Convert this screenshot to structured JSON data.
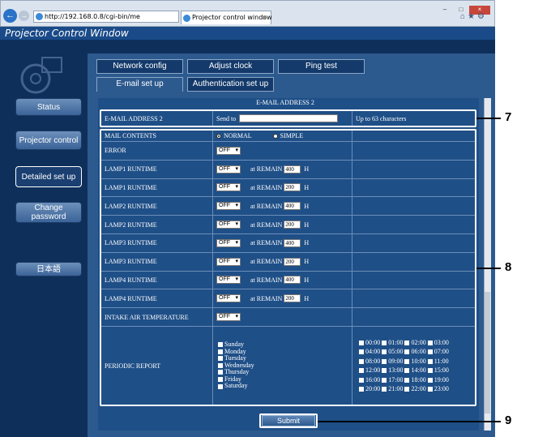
{
  "browser": {
    "address": "http://192.168.0.8/cgi-bin/me",
    "tab_title": "Projector control window"
  },
  "app_title": "Projector Control Window",
  "sidebar": [
    "Status",
    "Projector control",
    "Detailed set up",
    "Change password",
    "日本語"
  ],
  "tabs_top": [
    "Network config",
    "Adjust clock",
    "Ping test"
  ],
  "tabs_bottom": [
    "E-mail set up",
    "Authentication set up"
  ],
  "section_title": "E-MAIL ADDRESS 2",
  "email_row": {
    "label": "E-MAIL ADDRESS 2",
    "send_to": "Send to",
    "hint": "Up to 63 characters"
  },
  "mail_contents": {
    "label": "MAIL CONTENTS",
    "normal": "NORMAL",
    "simple": "SIMPLE",
    "selected": "NORMAL"
  },
  "rows": [
    {
      "label": "ERROR",
      "value": "OFF"
    },
    {
      "label": "LAMP1 RUNTIME",
      "value": "OFF",
      "remain": "400",
      "unit": "H"
    },
    {
      "label": "LAMP1 RUNTIME",
      "value": "OFF",
      "remain": "200",
      "unit": "H"
    },
    {
      "label": "LAMP2 RUNTIME",
      "value": "OFF",
      "remain": "400",
      "unit": "H"
    },
    {
      "label": "LAMP2 RUNTIME",
      "value": "OFF",
      "remain": "200",
      "unit": "H"
    },
    {
      "label": "LAMP3 RUNTIME",
      "value": "OFF",
      "remain": "400",
      "unit": "H"
    },
    {
      "label": "LAMP3 RUNTIME",
      "value": "OFF",
      "remain": "200",
      "unit": "H"
    },
    {
      "label": "LAMP4 RUNTIME",
      "value": "OFF",
      "remain": "400",
      "unit": "H"
    },
    {
      "label": "LAMP4 RUNTIME",
      "value": "OFF",
      "remain": "200",
      "unit": "H"
    },
    {
      "label": "INTAKE AIR TEMPERATURE",
      "value": "OFF"
    }
  ],
  "at_remain": "at REMAIN",
  "periodic": {
    "label": "PERIODIC REPORT",
    "days": [
      "Sunday",
      "Monday",
      "Tuesday",
      "Wednesday",
      "Thursday",
      "Friday",
      "Saturday"
    ],
    "times": [
      [
        "00:00",
        "01:00",
        "02:00",
        "03:00"
      ],
      [
        "04:00",
        "05:00",
        "06:00",
        "07:00"
      ],
      [
        "08:00",
        "09:00",
        "10:00",
        "11:00"
      ],
      [
        "12:00",
        "13:00",
        "14:00",
        "15:00"
      ],
      [
        "16:00",
        "17:00",
        "18:00",
        "19:00"
      ],
      [
        "20:00",
        "21:00",
        "22:00",
        "23:00"
      ]
    ]
  },
  "submit": "Submit",
  "callouts": [
    "7",
    "8",
    "9"
  ]
}
